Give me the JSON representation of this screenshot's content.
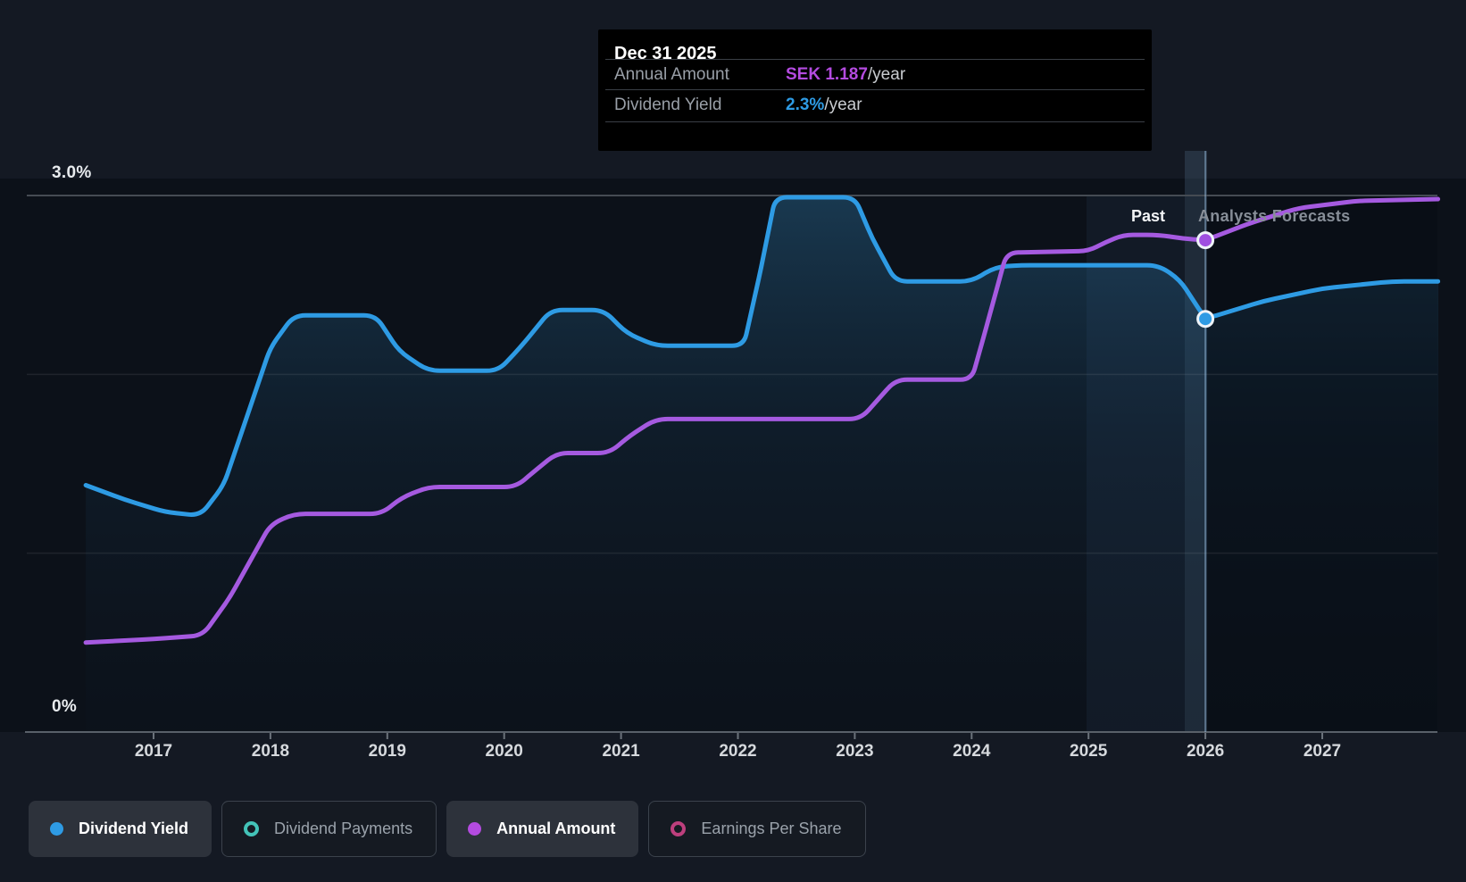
{
  "tooltip": {
    "title": "Dec 31 2025",
    "rows": [
      {
        "label": "Annual Amount",
        "value": "SEK 1.187",
        "suffix": "/year",
        "value_color": "#b44be0"
      },
      {
        "label": "Dividend Yield",
        "value": "2.3%",
        "suffix": "/year",
        "value_color": "#2e9be4"
      }
    ]
  },
  "annotations": {
    "past": "Past",
    "forecast": "Analysts Forecasts"
  },
  "y_axis": {
    "top_label": "3.0%",
    "bottom_label": "0%"
  },
  "legend": [
    {
      "label": "Dividend Yield",
      "swatch": "filled-blue-dot",
      "color": "#2e9be4",
      "active": true
    },
    {
      "label": "Dividend Payments",
      "swatch": "hollow-teal-ring",
      "color": "#43c3b8",
      "active": false
    },
    {
      "label": "Annual Amount",
      "swatch": "filled-purple-dot",
      "color": "#b44be0",
      "active": true
    },
    {
      "label": "Earnings Per Share",
      "swatch": "hollow-pink-ring",
      "color": "#bd3f7d",
      "active": false
    }
  ],
  "colors": {
    "dividend_yield_line": "#2e9be4",
    "annual_amount_line": "#a55ae0",
    "background": "#141923",
    "plot_background": "#0c1119",
    "tooltip_background": "#000000",
    "gridline_top": "#454b53",
    "axis_line": "#596069"
  },
  "chart_data": {
    "type": "line",
    "title": "",
    "x_ticks": [
      2017,
      2018,
      2019,
      2020,
      2021,
      2022,
      2023,
      2024,
      2025,
      2026,
      2027
    ],
    "x_range": [
      2016.42,
      2027.99
    ],
    "ylim": [
      0,
      3.1
    ],
    "y_gridlines_pct": [
      1,
      2,
      3
    ],
    "legend_position": "bottom",
    "grid": true,
    "past_forecast_divider_x": 2026,
    "note": "Annual Amount is drawn on a hidden secondary scale; its y values below are the left-axis percent-equivalent positions read from the chart. Tooltip gives its real value: SEK 1.187/year at Dec 31 2025.",
    "series": [
      {
        "name": "Dividend Yield",
        "unit": "%",
        "color": "#2e9be4",
        "points": [
          [
            2016.42,
            1.38
          ],
          [
            2016.75,
            1.3
          ],
          [
            2017.1,
            1.23
          ],
          [
            2017.4,
            1.21
          ],
          [
            2017.6,
            1.38
          ],
          [
            2018.0,
            2.15
          ],
          [
            2018.2,
            2.33
          ],
          [
            2018.9,
            2.33
          ],
          [
            2019.1,
            2.13
          ],
          [
            2019.35,
            2.02
          ],
          [
            2019.95,
            2.02
          ],
          [
            2020.15,
            2.16
          ],
          [
            2020.4,
            2.36
          ],
          [
            2020.85,
            2.36
          ],
          [
            2021.05,
            2.23
          ],
          [
            2021.3,
            2.16
          ],
          [
            2022.05,
            2.16
          ],
          [
            2022.2,
            2.6
          ],
          [
            2022.32,
            2.99
          ],
          [
            2023.0,
            2.99
          ],
          [
            2023.15,
            2.76
          ],
          [
            2023.35,
            2.52
          ],
          [
            2024.0,
            2.52
          ],
          [
            2024.2,
            2.6
          ],
          [
            2024.4,
            2.61
          ],
          [
            2025.6,
            2.61
          ],
          [
            2025.78,
            2.53
          ],
          [
            2026.0,
            2.31
          ],
          [
            2026.5,
            2.41
          ],
          [
            2027.0,
            2.48
          ],
          [
            2027.6,
            2.52
          ],
          [
            2027.99,
            2.52
          ]
        ]
      },
      {
        "name": "Annual Amount",
        "unit": "axis-percent-equivalent",
        "color": "#a55ae0",
        "points": [
          [
            2016.42,
            0.5
          ],
          [
            2017.0,
            0.52
          ],
          [
            2017.42,
            0.54
          ],
          [
            2017.65,
            0.75
          ],
          [
            2018.0,
            1.16
          ],
          [
            2018.2,
            1.22
          ],
          [
            2018.95,
            1.22
          ],
          [
            2019.12,
            1.31
          ],
          [
            2019.35,
            1.37
          ],
          [
            2020.1,
            1.37
          ],
          [
            2020.28,
            1.47
          ],
          [
            2020.45,
            1.56
          ],
          [
            2020.9,
            1.56
          ],
          [
            2021.08,
            1.66
          ],
          [
            2021.3,
            1.75
          ],
          [
            2023.05,
            1.75
          ],
          [
            2023.2,
            1.86
          ],
          [
            2023.35,
            1.97
          ],
          [
            2024.0,
            1.97
          ],
          [
            2024.12,
            2.25
          ],
          [
            2024.3,
            2.68
          ],
          [
            2025.0,
            2.69
          ],
          [
            2025.15,
            2.74
          ],
          [
            2025.3,
            2.78
          ],
          [
            2025.6,
            2.78
          ],
          [
            2025.8,
            2.76
          ],
          [
            2026.0,
            2.75
          ],
          [
            2026.4,
            2.85
          ],
          [
            2026.8,
            2.93
          ],
          [
            2027.3,
            2.97
          ],
          [
            2027.99,
            2.98
          ]
        ]
      }
    ],
    "markers": [
      {
        "series": "Dividend Yield",
        "x": 2026.0,
        "y": 2.31,
        "color": "#2e9be4"
      },
      {
        "series": "Annual Amount",
        "x": 2026.0,
        "y": 2.75,
        "color": "#9f4fe0"
      }
    ]
  }
}
